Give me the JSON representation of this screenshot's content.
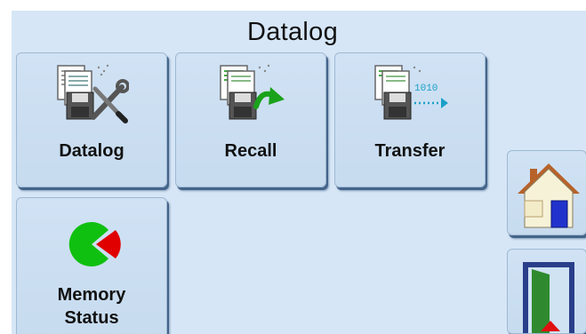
{
  "screen": {
    "title": "Datalog"
  },
  "tiles": [
    {
      "label": "Datalog",
      "icon": "datalog-settings-icon"
    },
    {
      "label": "Recall",
      "icon": "recall-icon"
    },
    {
      "label": "Transfer",
      "icon": "transfer-icon"
    },
    {
      "label_line1": "Memory",
      "label_line2": "Status",
      "icon": "memory-status-pie-icon"
    }
  ],
  "side_buttons": [
    {
      "icon": "home-icon"
    },
    {
      "icon": "exit-door-icon"
    }
  ],
  "colors": {
    "background": "#d6e6f6",
    "tile": "#c9ddf1",
    "tile_shadow": "#44648a",
    "memory_used": "#e00000",
    "memory_free": "#10c010"
  }
}
